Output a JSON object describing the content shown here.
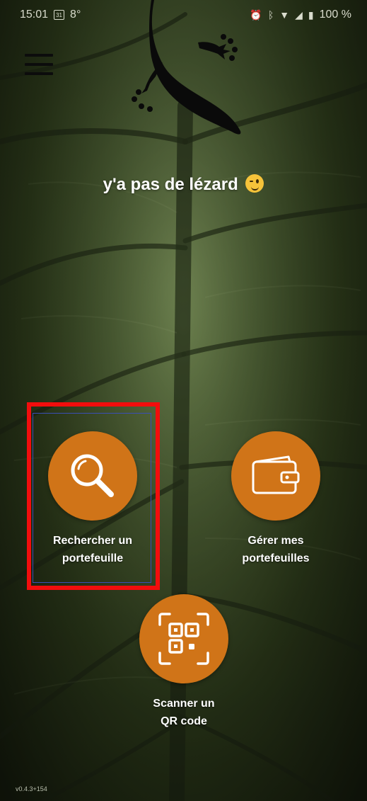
{
  "status_bar": {
    "time": "15:01",
    "calendar_day": "31",
    "temperature": "8°",
    "battery": "100 %",
    "icons": [
      "calendar-icon",
      "alarm-icon",
      "bluetooth-icon",
      "wifi-icon",
      "signal-icon",
      "battery-icon"
    ]
  },
  "header": {
    "menu_icon": "hamburger-menu-icon",
    "logo_icon": "gecko-logo"
  },
  "headline": {
    "text": "y'a pas de lézard",
    "emoji": "winking-face-emoji"
  },
  "actions": [
    {
      "id": "search",
      "label": "Rechercher un\nportefeuille",
      "icon": "magnifier-icon",
      "highlighted": true
    },
    {
      "id": "wallet",
      "label": "Gérer mes\nportefeuilles",
      "icon": "wallet-icon",
      "highlighted": false
    },
    {
      "id": "qr",
      "label": "Scanner un\nQR code",
      "icon": "qr-code-icon",
      "highlighted": false
    }
  ],
  "footer": {
    "version": "v0.4.3+154"
  },
  "colors": {
    "accent": "#d07418",
    "highlight": "#f20d0d",
    "text": "#ffffff"
  }
}
